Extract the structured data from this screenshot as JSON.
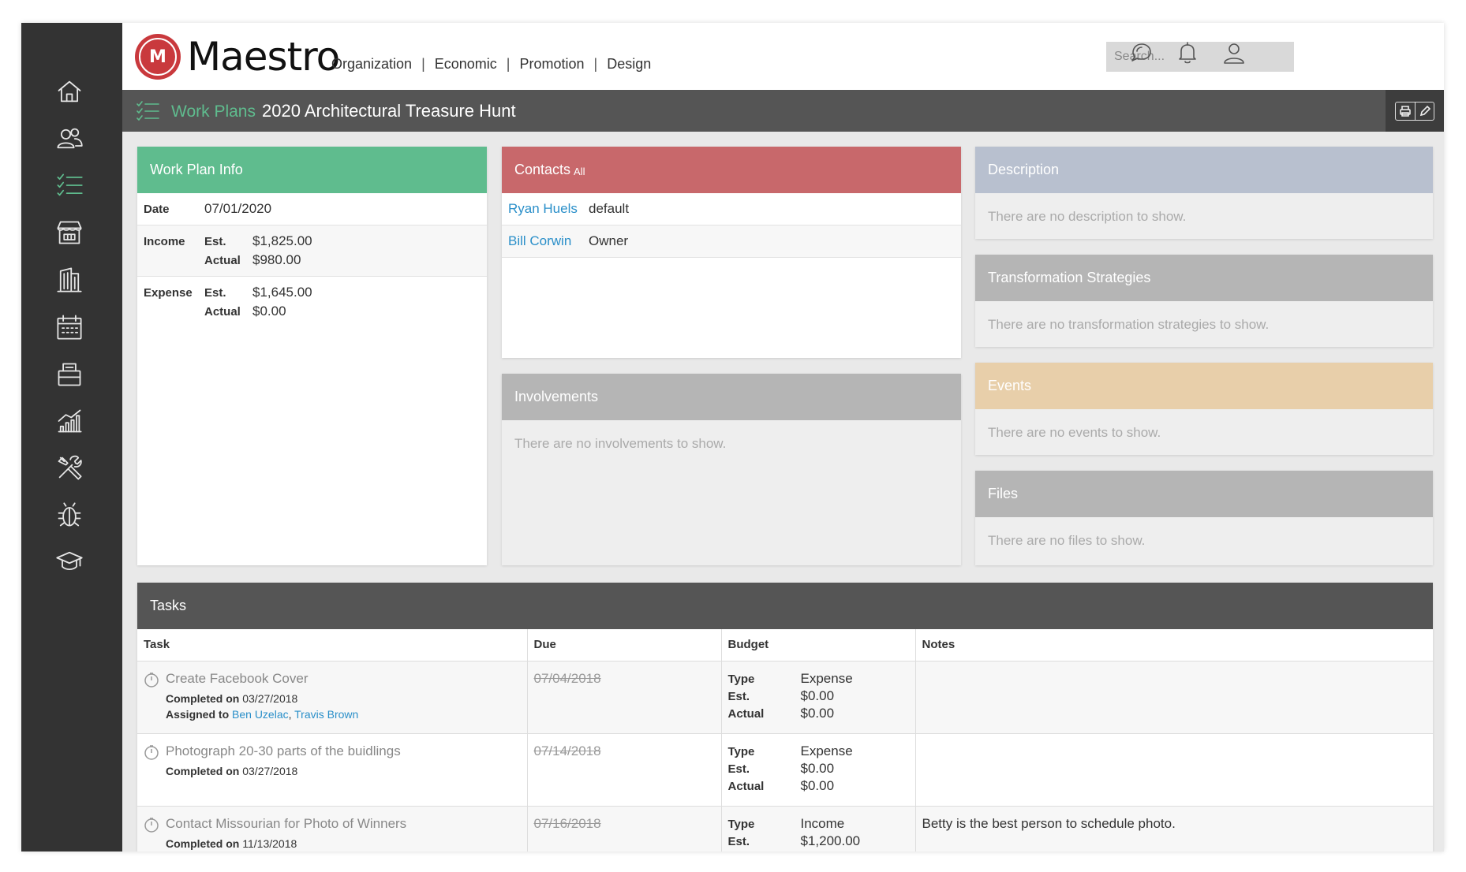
{
  "app": {
    "name": "Maestro",
    "logo_initials": "M"
  },
  "topnav": [
    "Organization",
    "Economic",
    "Promotion",
    "Design"
  ],
  "search": {
    "placeholder": "Search..."
  },
  "breadcrumb": {
    "section": "Work Plans",
    "title": "2020 Architectural Treasure Hunt"
  },
  "sidebar_icons": [
    "home-icon",
    "people-icon",
    "checklist-icon",
    "storefront-icon",
    "building-icon",
    "calendar-icon",
    "wallet-icon",
    "chart-icon",
    "tools-icon",
    "bug-icon",
    "graduation-cap-icon"
  ],
  "work_plan_info": {
    "header": "Work Plan Info",
    "date_label": "Date",
    "date": "07/01/2020",
    "income_label": "Income",
    "income_est_label": "Est.",
    "income_est": "$1,825.00",
    "income_actual_label": "Actual",
    "income_actual": "$980.00",
    "expense_label": "Expense",
    "expense_est_label": "Est.",
    "expense_est": "$1,645.00",
    "expense_actual_label": "Actual",
    "expense_actual": "$0.00"
  },
  "contacts": {
    "header": "Contacts",
    "header_suffix": "All",
    "rows": [
      {
        "name": "Ryan Huels",
        "role": "default"
      },
      {
        "name": "Bill Corwin",
        "role": "Owner"
      }
    ]
  },
  "involvements": {
    "header": "Involvements",
    "empty": "There are no involvements to show."
  },
  "description": {
    "header": "Description",
    "empty": "There are no description to show."
  },
  "strategies": {
    "header": "Transformation Strategies",
    "empty": "There are no transformation strategies to show."
  },
  "events": {
    "header": "Events",
    "empty": "There are no events to show."
  },
  "files": {
    "header": "Files",
    "empty": "There are no files to show."
  },
  "tasks": {
    "header": "Tasks",
    "columns": [
      "Task",
      "Due",
      "Budget",
      "Notes"
    ],
    "completed_label": "Completed on",
    "assigned_label": "Assigned to",
    "type_label": "Type",
    "est_label": "Est.",
    "actual_label": "Actual",
    "rows": [
      {
        "name": "Create Facebook Cover",
        "completed": "03/27/2018",
        "assigned_a": "Ben Uzelac",
        "assigned_b": "Travis Brown",
        "due": "07/04/2018",
        "type": "Expense",
        "est": "$0.00",
        "actual": "$0.00",
        "notes": ""
      },
      {
        "name": "Photograph 20-30 parts of the buidlings",
        "completed": "03/27/2018",
        "due": "07/14/2018",
        "type": "Expense",
        "est": "$0.00",
        "actual": "$0.00",
        "notes": ""
      },
      {
        "name": "Contact Missourian for Photo of Winners",
        "completed": "11/13/2018",
        "due": "07/16/2018",
        "type": "Income",
        "est": "$1,200.00",
        "notes": "Betty is the best person to schedule photo."
      }
    ]
  },
  "colors": {
    "sidebar": "#333333",
    "accent_green": "#5fbc8e",
    "contacts_red": "#c8686b",
    "description_blue": "#b8c0cf",
    "events_tan": "#e8cfaa",
    "neutral_gray": "#b5b5b5",
    "link_blue": "#2a8fc9"
  }
}
